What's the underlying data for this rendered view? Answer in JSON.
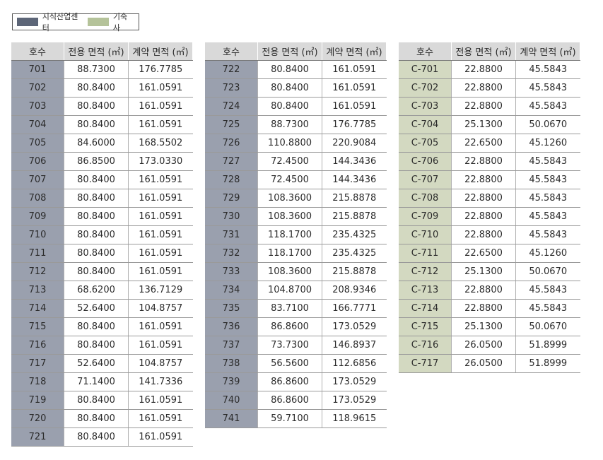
{
  "legend": [
    {
      "label": "지식산업센터",
      "color": "#5d6678"
    },
    {
      "label": "기숙사",
      "color": "#b5c39a"
    }
  ],
  "colors": {
    "office": "#9aa0ae",
    "dorm": "#d3d9c1",
    "header": "#d9d9d9"
  },
  "tables": [
    {
      "headers": [
        "호수",
        "전용 면적 (㎡)",
        "계약 면적 (㎡)"
      ],
      "type": "office",
      "rows": [
        [
          "701",
          "88.7300",
          "176.7785"
        ],
        [
          "702",
          "80.8400",
          "161.0591"
        ],
        [
          "703",
          "80.8400",
          "161.0591"
        ],
        [
          "704",
          "80.8400",
          "161.0591"
        ],
        [
          "705",
          "84.6000",
          "168.5502"
        ],
        [
          "706",
          "86.8500",
          "173.0330"
        ],
        [
          "707",
          "80.8400",
          "161.0591"
        ],
        [
          "708",
          "80.8400",
          "161.0591"
        ],
        [
          "709",
          "80.8400",
          "161.0591"
        ],
        [
          "710",
          "80.8400",
          "161.0591"
        ],
        [
          "711",
          "80.8400",
          "161.0591"
        ],
        [
          "712",
          "80.8400",
          "161.0591"
        ],
        [
          "713",
          "68.6200",
          "136.7129"
        ],
        [
          "714",
          "52.6400",
          "104.8757"
        ],
        [
          "715",
          "80.8400",
          "161.0591"
        ],
        [
          "716",
          "80.8400",
          "161.0591"
        ],
        [
          "717",
          "52.6400",
          "104.8757"
        ],
        [
          "718",
          "71.1400",
          "141.7336"
        ],
        [
          "719",
          "80.8400",
          "161.0591"
        ],
        [
          "720",
          "80.8400",
          "161.0591"
        ],
        [
          "721",
          "80.8400",
          "161.0591"
        ]
      ]
    },
    {
      "headers": [
        "호수",
        "전용 면적 (㎡)",
        "계약 면적 (㎡)"
      ],
      "type": "office",
      "rows": [
        [
          "722",
          "80.8400",
          "161.0591"
        ],
        [
          "723",
          "80.8400",
          "161.0591"
        ],
        [
          "724",
          "80.8400",
          "161.0591"
        ],
        [
          "725",
          "88.7300",
          "176.7785"
        ],
        [
          "726",
          "110.8800",
          "220.9084"
        ],
        [
          "727",
          "72.4500",
          "144.3436"
        ],
        [
          "728",
          "72.4500",
          "144.3436"
        ],
        [
          "729",
          "108.3600",
          "215.8878"
        ],
        [
          "730",
          "108.3600",
          "215.8878"
        ],
        [
          "731",
          "118.1700",
          "235.4325"
        ],
        [
          "732",
          "118.1700",
          "235.4325"
        ],
        [
          "733",
          "108.3600",
          "215.8878"
        ],
        [
          "734",
          "104.8700",
          "208.9346"
        ],
        [
          "735",
          "83.7100",
          "166.7771"
        ],
        [
          "736",
          "86.8600",
          "173.0529"
        ],
        [
          "737",
          "73.7300",
          "146.8937"
        ],
        [
          "738",
          "56.5600",
          "112.6856"
        ],
        [
          "739",
          "86.8600",
          "173.0529"
        ],
        [
          "740",
          "86.8600",
          "173.0529"
        ],
        [
          "741",
          "59.7100",
          "118.9615"
        ]
      ]
    },
    {
      "headers": [
        "호수",
        "전용 면적 (㎡)",
        "계약 면적 (㎡)"
      ],
      "type": "dorm",
      "rows": [
        [
          "C-701",
          "22.8800",
          "45.5843"
        ],
        [
          "C-702",
          "22.8800",
          "45.5843"
        ],
        [
          "C-703",
          "22.8800",
          "45.5843"
        ],
        [
          "C-704",
          "25.1300",
          "50.0670"
        ],
        [
          "C-705",
          "22.6500",
          "45.1260"
        ],
        [
          "C-706",
          "22.8800",
          "45.5843"
        ],
        [
          "C-707",
          "22.8800",
          "45.5843"
        ],
        [
          "C-708",
          "22.8800",
          "45.5843"
        ],
        [
          "C-709",
          "22.8800",
          "45.5843"
        ],
        [
          "C-710",
          "22.8800",
          "45.5843"
        ],
        [
          "C-711",
          "22.6500",
          "45.1260"
        ],
        [
          "C-712",
          "25.1300",
          "50.0670"
        ],
        [
          "C-713",
          "22.8800",
          "45.5843"
        ],
        [
          "C-714",
          "22.8800",
          "45.5843"
        ],
        [
          "C-715",
          "25.1300",
          "50.0670"
        ],
        [
          "C-716",
          "26.0500",
          "51.8999"
        ],
        [
          "C-717",
          "26.0500",
          "51.8999"
        ]
      ]
    }
  ]
}
